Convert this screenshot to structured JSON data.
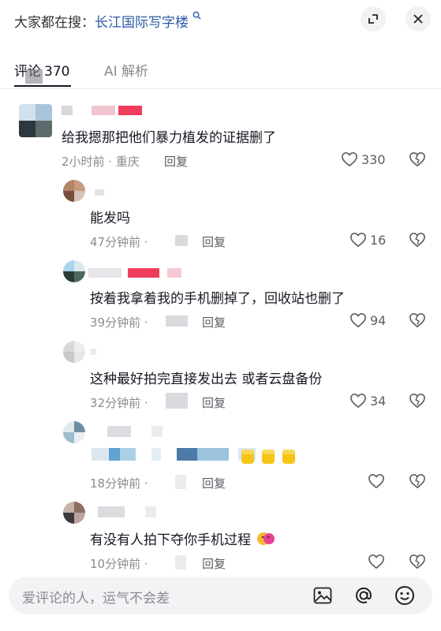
{
  "search": {
    "prefix": "大家都在搜：",
    "keyword": "长江国际写字楼"
  },
  "tabs": [
    {
      "label": "评论",
      "count": "370"
    },
    {
      "label": "AI 解析"
    }
  ],
  "comments": [
    {
      "text": "给我摁那把他们暴力植发的证据删了",
      "time": "2小时前 · 重庆",
      "reply": "回复",
      "likes": "330",
      "avatar_colors": [
        "#cfe0ee",
        "#a9c4d8",
        "#2e3640",
        "#5d6b6a"
      ]
    },
    {
      "text": "能发吗",
      "time": "47分钟前 ·",
      "reply": "回复",
      "likes": "16",
      "avatar_colors": [
        "#b48468",
        "#c99a7c",
        "#7a4e3c",
        "#d7c2b5"
      ]
    },
    {
      "text": "按着我拿着我的手机删掉了，回收站也删了",
      "time": "39分钟前 ·",
      "reply": "回复",
      "likes": "94",
      "avatar_colors": [
        "#a7d7ea",
        "#dbe9ef",
        "#2d3a36",
        "#4c6a5c"
      ]
    },
    {
      "text": "这种最好拍完直接发出去 或者云盘备份",
      "time": "32分钟前 ·",
      "reply": "回复",
      "likes": "34",
      "avatar_colors": [
        "#d9d9d9",
        "#eeeeee",
        "#c8c8c8",
        "#e5e5e5"
      ]
    },
    {
      "text": "",
      "time": "18分钟前 ·",
      "reply": "回复",
      "likes": "",
      "avatar_colors": [
        "#dfe9ee",
        "#6e8fa3",
        "#9fbccb",
        "#e8eef1"
      ]
    },
    {
      "text": "有没有人拍下夺你手机过程",
      "time": "10分钟前 ·",
      "reply": "回复",
      "likes": "",
      "avatar_colors": [
        "#c7b2a7",
        "#8c6f63",
        "#3c3a3a",
        "#b9a59c"
      ]
    }
  ],
  "input": {
    "placeholder": "爱评论的人，运气不会差"
  },
  "icons": [
    "expand-icon",
    "close-icon",
    "heart-icon",
    "dislike-icon",
    "image-icon",
    "at-icon",
    "emoji-icon",
    "search-icon"
  ],
  "colors": {
    "link": "#2b5aa5",
    "muted": "#8a8b91",
    "emoji_yellow": "#f5c518"
  }
}
